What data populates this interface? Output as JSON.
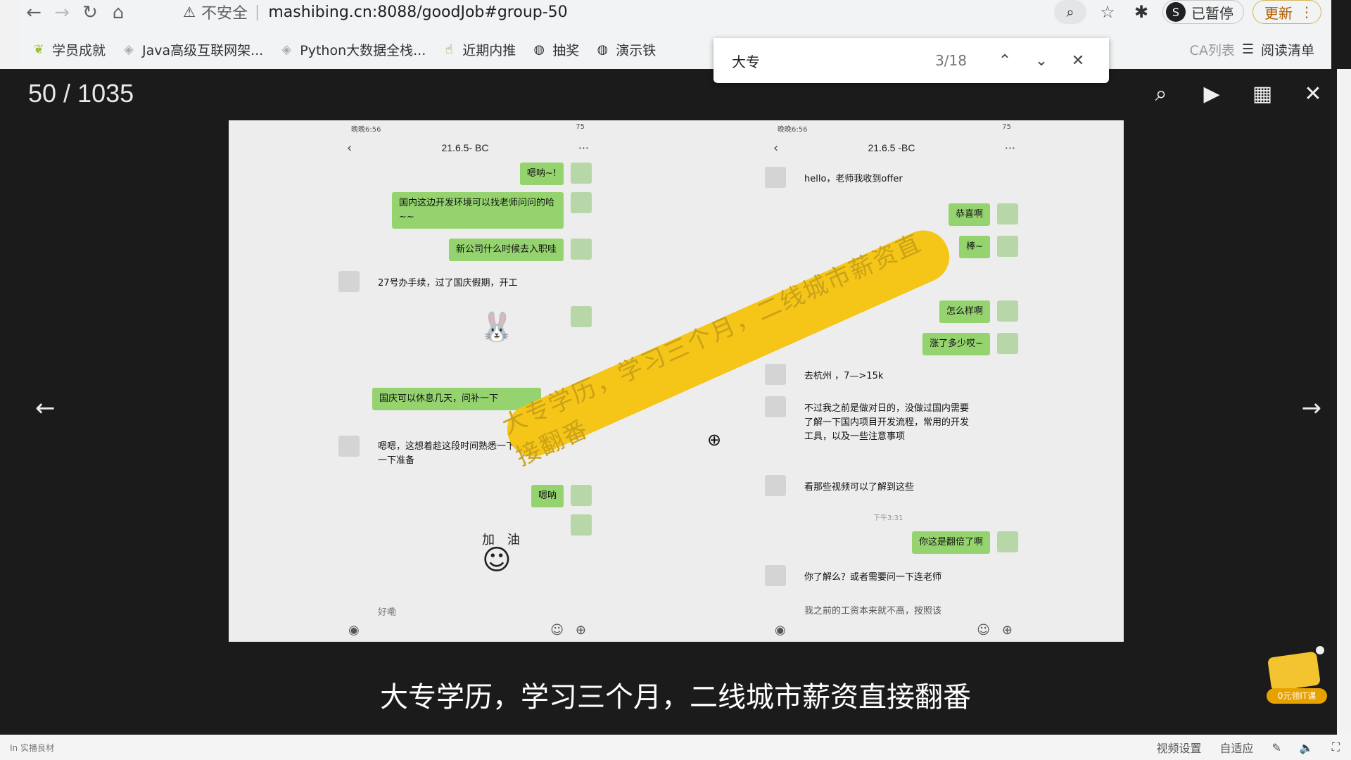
{
  "browser": {
    "insecure_label": "不安全",
    "url": "mashibing.cn:8088/goodJob#group-50",
    "profile_status": "已暂停",
    "profile_initial": "S",
    "update_label": "更新"
  },
  "bookmarks": [
    {
      "label": "学员成就"
    },
    {
      "label": "Java高级互联网架..."
    },
    {
      "label": "Python大数据全栈..."
    },
    {
      "label": "近期内推"
    },
    {
      "label": "抽奖"
    },
    {
      "label": "演示铁"
    }
  ],
  "bookmarks_right": {
    "partial_label": "CA列表",
    "reading_list": "阅读清单"
  },
  "find_bar": {
    "query": "大专",
    "count": "3/18"
  },
  "viewer": {
    "counter": "50 / 1035"
  },
  "phone_left": {
    "status_time": "晚晚6:56",
    "status_battery": "75",
    "title": "21.6.5-   BC",
    "messages": [
      {
        "text": "嗯呐~!"
      },
      {
        "text": "国内这边开发环境可以找老师问问的哈~~"
      },
      {
        "text": "新公司什么时候去入职哇"
      },
      {
        "text": "27号办手续，过了国庆假期，开工"
      },
      {
        "text": "国庆可以休息几天，问补一下"
      },
      {
        "text": "嗯嗯，这想着趁这段时间熟悉一下，做一下准备"
      },
      {
        "text": "嗯呐"
      },
      {
        "text": "好嘞"
      }
    ],
    "sticker_text": "加 油"
  },
  "phone_right": {
    "status_time": "晚晚6:56",
    "status_battery": "75",
    "title": "21.6.5    -BC",
    "messages": [
      {
        "text": "hello，老师我收到offer"
      },
      {
        "text": "恭喜啊"
      },
      {
        "text": "棒~"
      },
      {
        "text": "怎么样啊"
      },
      {
        "text": "涨了多少哎~"
      },
      {
        "text": "去杭州      ，7—>15k"
      },
      {
        "text": "不过我之前是做对日的，没做过国内需要了解一下国内项目开发流程，常用的开发工具，以及一些注意事项"
      },
      {
        "text": "看那些视频可以了解到这些"
      },
      {
        "text": "你这是翻倍了啊"
      },
      {
        "text": "你了解么？或者需要问一下连老师"
      },
      {
        "text": "我之前的工资本来就不高，按照该"
      }
    ],
    "time_chip": "下午3:31"
  },
  "banner_text": "大专学历，学习三个月，二线城市薪资直接翻番",
  "subtitle": "大专学历，学习三个月，二线城市薪资直接翻番",
  "mascot_tag": "0元领IT课",
  "player": {
    "left_label": "In 实播良材",
    "video_settings": "视频设置",
    "adaptive": "自适应"
  }
}
